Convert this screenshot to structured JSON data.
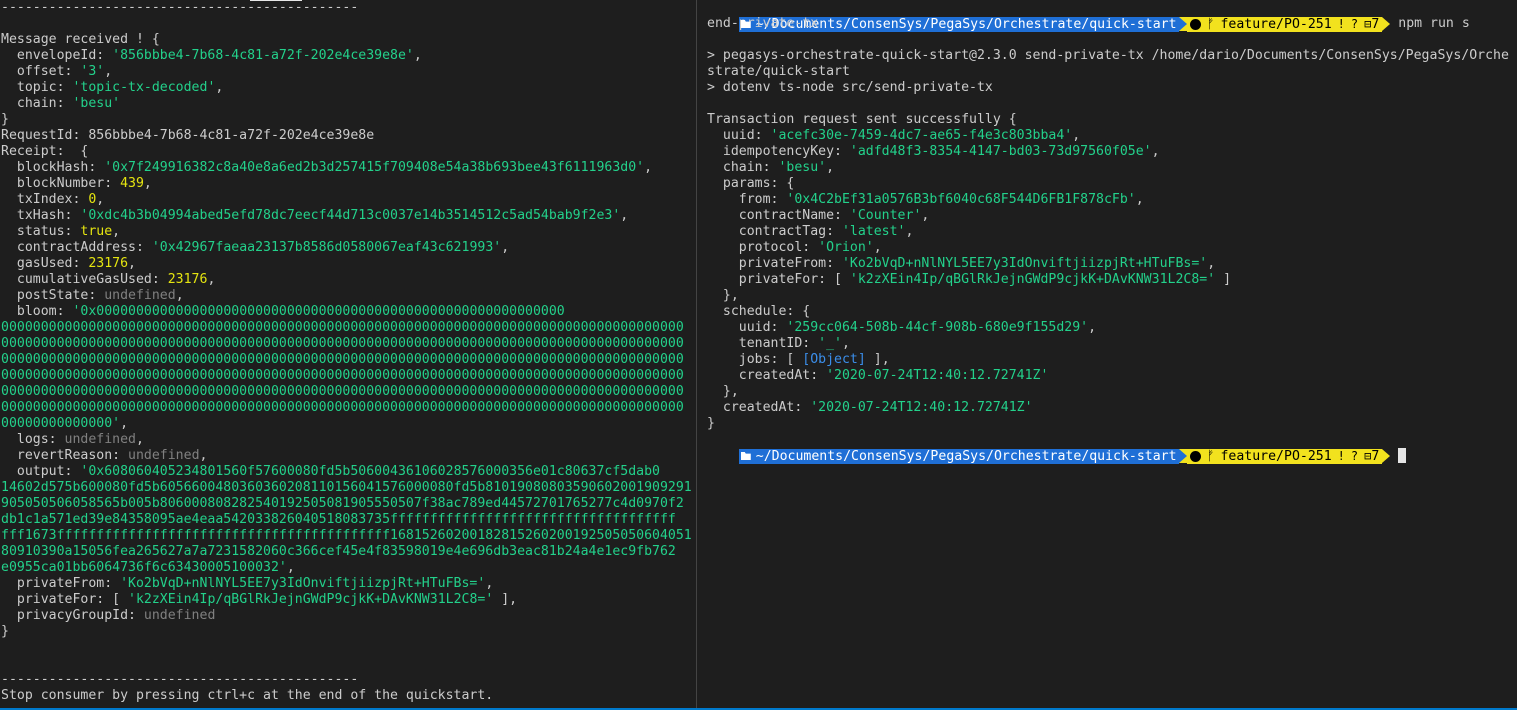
{
  "left_terminal": {
    "lines": [
      [
        {
          "t": "---------------------------------------------"
        }
      ],
      [
        {
          "t": ""
        }
      ],
      [
        {
          "t": "Message received ! {"
        }
      ],
      [
        {
          "t": "  envelopeId: "
        },
        {
          "t": "'856bbbe4-7b68-4c81-a72f-202e4ce39e8e'",
          "c": "s"
        },
        {
          "t": ","
        }
      ],
      [
        {
          "t": "  offset: "
        },
        {
          "t": "'3'",
          "c": "s"
        },
        {
          "t": ","
        }
      ],
      [
        {
          "t": "  topic: "
        },
        {
          "t": "'topic-tx-decoded'",
          "c": "s"
        },
        {
          "t": ","
        }
      ],
      [
        {
          "t": "  chain: "
        },
        {
          "t": "'besu'",
          "c": "s"
        }
      ],
      [
        {
          "t": "}"
        }
      ],
      [
        {
          "t": "RequestId: 856bbbe4-7b68-4c81-a72f-202e4ce39e8e"
        }
      ],
      [
        {
          "t": "Receipt:  {"
        }
      ],
      [
        {
          "t": "  blockHash: "
        },
        {
          "t": "'0x7f249916382c8a40e8a6ed2b3d257415f709408e54a38b693bee43f6111963d0'",
          "c": "s"
        },
        {
          "t": ","
        }
      ],
      [
        {
          "t": "  blockNumber: "
        },
        {
          "t": "439",
          "c": "n"
        },
        {
          "t": ","
        }
      ],
      [
        {
          "t": "  txIndex: "
        },
        {
          "t": "0",
          "c": "n"
        },
        {
          "t": ","
        }
      ],
      [
        {
          "t": "  txHash: "
        },
        {
          "t": "'0xdc4b3b04994abed5efd78dc7eecf44d713c0037e14b3514512c5ad54bab9f2e3'",
          "c": "s"
        },
        {
          "t": ","
        }
      ],
      [
        {
          "t": "  status: "
        },
        {
          "t": "true",
          "c": "n"
        },
        {
          "t": ","
        }
      ],
      [
        {
          "t": "  contractAddress: "
        },
        {
          "t": "'0x42967faeaa23137b8586d0580067eaf43c621993'",
          "c": "s"
        },
        {
          "t": ","
        }
      ],
      [
        {
          "t": "  gasUsed: "
        },
        {
          "t": "23176",
          "c": "n"
        },
        {
          "t": ","
        }
      ],
      [
        {
          "t": "  cumulativeGasUsed: "
        },
        {
          "t": "23176",
          "c": "n"
        },
        {
          "t": ","
        }
      ],
      [
        {
          "t": "  postState: "
        },
        {
          "t": "undefined",
          "c": "u"
        },
        {
          "t": ","
        }
      ],
      [
        {
          "t": "  bloom: "
        },
        {
          "t": "'0x00000000000000000000000000000000000000000000000000000000000",
          "c": "s"
        }
      ],
      [
        {
          "t": "00000000000000000000000000000000000000000000000000000000000000000000000000000000000000",
          "c": "s"
        }
      ],
      [
        {
          "t": "00000000000000000000000000000000000000000000000000000000000000000000000000000000000000",
          "c": "s"
        }
      ],
      [
        {
          "t": "00000000000000000000000000000000000000000000000000000000000000000000000000000000000000",
          "c": "s"
        }
      ],
      [
        {
          "t": "00000000000000000000000000000000000000000000000000000000000000000000000000000000000000",
          "c": "s"
        }
      ],
      [
        {
          "t": "00000000000000000000000000000000000000000000000000000000000000000000000000000000000000",
          "c": "s"
        }
      ],
      [
        {
          "t": "00000000000000000000000000000000000000000000000000000000000000000000000000000000000000",
          "c": "s"
        }
      ],
      [
        {
          "t": "00000000000000'",
          "c": "s"
        },
        {
          "t": ","
        }
      ],
      [
        {
          "t": "  logs: "
        },
        {
          "t": "undefined",
          "c": "u"
        },
        {
          "t": ","
        }
      ],
      [
        {
          "t": "  revertReason: "
        },
        {
          "t": "undefined",
          "c": "u"
        },
        {
          "t": ","
        }
      ],
      [
        {
          "t": "  output: "
        },
        {
          "t": "'0x608060405234801560f57600080fd5b50600436106028576000356e01c80637cf5dab0",
          "c": "s"
        }
      ],
      [
        {
          "t": "14602d575b600080fd5b6056600480360360208110156041576000080fd5b81019080803590602001909291",
          "c": "s"
        }
      ],
      [
        {
          "t": "905050506058565b005b806000808282540192505081905550507f38ac789ed44572701765277c4d0970f2",
          "c": "s"
        }
      ],
      [
        {
          "t": "db1c1a571ed39e84358095ae4eaa542033826040518083735ffffffffffffffffffffffffffffffffffff",
          "c": "s"
        }
      ],
      [
        {
          "t": "fff1673ffffffffffffffffffffffffffffffffffffffffff16815260200182815260200192505050604051",
          "c": "s"
        }
      ],
      [
        {
          "t": "80910390a15056fea265627a7a7231582060c366cef45e4f83598019e4e696db3eac81b24a4e1ec9fb762",
          "c": "s"
        }
      ],
      [
        {
          "t": "e0955ca01bb6064736f6c63430005100032'",
          "c": "s"
        },
        {
          "t": ","
        }
      ],
      [
        {
          "t": "  privateFrom: "
        },
        {
          "t": "'Ko2bVqD+nNlNYL5EE7y3IdOnviftjiizpjRt+HTuFBs='",
          "c": "s"
        },
        {
          "t": ","
        }
      ],
      [
        {
          "t": "  privateFor: [ "
        },
        {
          "t": "'k2zXEin4Ip/qBGlRkJejnGWdP9cjkK+DAvKNW31L2C8='",
          "c": "s"
        },
        {
          "t": " ],"
        }
      ],
      [
        {
          "t": "  privacyGroupId: "
        },
        {
          "t": "undefined",
          "c": "u"
        }
      ],
      [
        {
          "t": "}"
        }
      ],
      [
        {
          "t": ""
        }
      ],
      [
        {
          "t": ""
        }
      ],
      [
        {
          "t": "---------------------------------------------"
        }
      ],
      [
        {
          "t": "Stop consumer by pressing ctrl+c at the end of the quickstart."
        }
      ]
    ]
  },
  "right_terminal": {
    "prompt": {
      "path": "~/Documents/ConsenSys/PegaSys/Orchestrate/quick-start",
      "branch_symbol": "ᚠ",
      "branch": "feature/PO-251",
      "stash_count": "7",
      "exclaim": "!",
      "question": "?"
    },
    "command_head": "npm run s",
    "lines_after_prompt": [
      [
        {
          "t": "end-private-tx"
        }
      ],
      [
        {
          "t": ""
        }
      ],
      [
        {
          "t": "> pegasys-orchestrate-quick-start@2.3.0 send-private-tx /home/dario/Documents/ConsenSys/PegaSys/Orche"
        }
      ],
      [
        {
          "t": "strate/quick-start"
        }
      ],
      [
        {
          "t": "> dotenv ts-node src/send-private-tx"
        }
      ],
      [
        {
          "t": ""
        }
      ],
      [
        {
          "t": "Transaction request sent successfully {"
        }
      ],
      [
        {
          "t": "  uuid: "
        },
        {
          "t": "'acefc30e-7459-4dc7-ae65-f4e3c803bba4'",
          "c": "s"
        },
        {
          "t": ","
        }
      ],
      [
        {
          "t": "  idempotencyKey: "
        },
        {
          "t": "'adfd48f3-8354-4147-bd03-73d97560f05e'",
          "c": "s"
        },
        {
          "t": ","
        }
      ],
      [
        {
          "t": "  chain: "
        },
        {
          "t": "'besu'",
          "c": "s"
        },
        {
          "t": ","
        }
      ],
      [
        {
          "t": "  params: {"
        }
      ],
      [
        {
          "t": "    from: "
        },
        {
          "t": "'0x4C2bEf31a0576B3bf6040c68F544D6FB1F878cFb'",
          "c": "s"
        },
        {
          "t": ","
        }
      ],
      [
        {
          "t": "    contractName: "
        },
        {
          "t": "'Counter'",
          "c": "s"
        },
        {
          "t": ","
        }
      ],
      [
        {
          "t": "    contractTag: "
        },
        {
          "t": "'latest'",
          "c": "s"
        },
        {
          "t": ","
        }
      ],
      [
        {
          "t": "    protocol: "
        },
        {
          "t": "'Orion'",
          "c": "s"
        },
        {
          "t": ","
        }
      ],
      [
        {
          "t": "    privateFrom: "
        },
        {
          "t": "'Ko2bVqD+nNlNYL5EE7y3IdOnviftjiizpjRt+HTuFBs='",
          "c": "s"
        },
        {
          "t": ","
        }
      ],
      [
        {
          "t": "    privateFor: [ "
        },
        {
          "t": "'k2zXEin4Ip/qBGlRkJejnGWdP9cjkK+DAvKNW31L2C8='",
          "c": "s"
        },
        {
          "t": " ]"
        }
      ],
      [
        {
          "t": "  },"
        }
      ],
      [
        {
          "t": "  schedule: {"
        }
      ],
      [
        {
          "t": "    uuid: "
        },
        {
          "t": "'259cc064-508b-44cf-908b-680e9f155d29'",
          "c": "s"
        },
        {
          "t": ","
        }
      ],
      [
        {
          "t": "    tenantID: "
        },
        {
          "t": "'_'",
          "c": "s"
        },
        {
          "t": ","
        }
      ],
      [
        {
          "t": "    jobs: [ "
        },
        {
          "t": "[Object]",
          "c": "o"
        },
        {
          "t": " ],"
        }
      ],
      [
        {
          "t": "    createdAt: "
        },
        {
          "t": "'2020-07-24T12:40:12.72741Z'",
          "c": "s"
        }
      ],
      [
        {
          "t": "  },"
        }
      ],
      [
        {
          "t": "  createdAt: "
        },
        {
          "t": "'2020-07-24T12:40:12.72741Z'",
          "c": "s"
        }
      ],
      [
        {
          "t": "}"
        }
      ]
    ]
  },
  "colors": {
    "background": "#1e1e1e",
    "text": "#cccccc",
    "string": "#23d18b",
    "number": "#e5e510",
    "undefined": "#808080",
    "object": "#3b8eea",
    "prompt_dir_bg": "#1f6fd6",
    "prompt_git_bg": "#f2e21e"
  }
}
